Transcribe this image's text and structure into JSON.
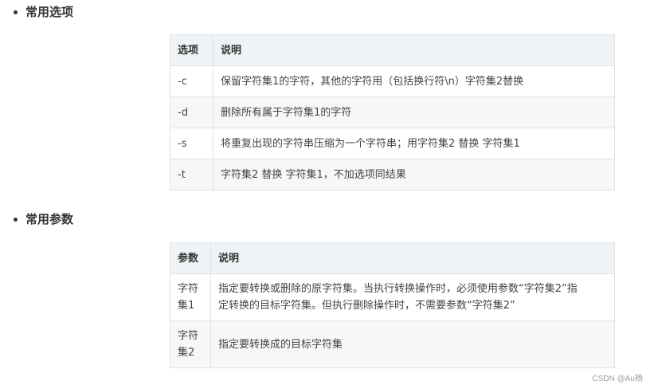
{
  "section1": {
    "heading": "常用选项",
    "headers": [
      "选项",
      "说明"
    ],
    "rows": [
      {
        "key": "-c",
        "desc": "保留字符集1的字符，其他的字符用（包括换行符\\n）字符集2替换"
      },
      {
        "key": "-d",
        "desc": "删除所有属于字符集1的字符"
      },
      {
        "key": "-s",
        "desc": "将重复出现的字符串压缩为一个字符串；用字符集2 替换 字符集1"
      },
      {
        "key": "-t",
        "desc": "字符集2 替换 字符集1，不加选项同结果"
      }
    ]
  },
  "section2": {
    "heading": "常用参数",
    "headers": [
      "参数",
      "说明"
    ],
    "rows": [
      {
        "key_line1": "字符",
        "key_line2": "集1",
        "desc_line1": "指定要转换或删除的原字符集。当执行转换操作时，必须使用参数“字符集2”指",
        "desc_line2": "定转换的目标字符集。但执行删除操作时，不需要参数“字符集2”"
      },
      {
        "key_line1": "字符",
        "key_line2": "集2",
        "desc": "指定要转换成的目标字符集"
      }
    ]
  },
  "watermark": "CSDN @Au杨"
}
